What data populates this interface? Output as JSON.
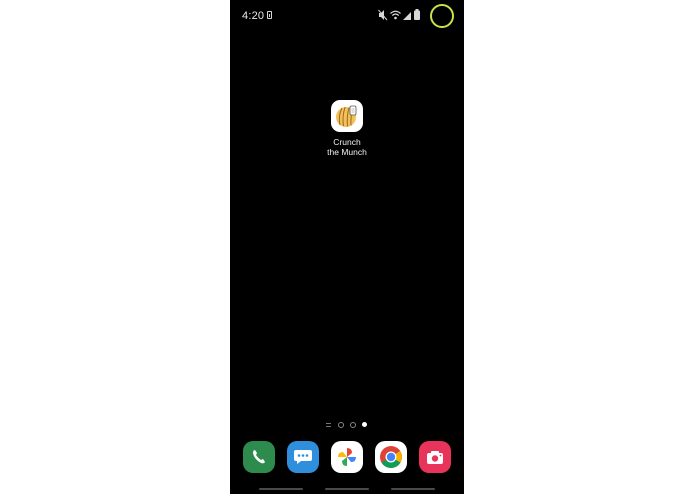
{
  "status_bar": {
    "time": "4:20",
    "icons": [
      "battery-saver-icon",
      "mute-icon",
      "wifi-icon",
      "signal-icon",
      "battery-icon"
    ]
  },
  "home_screen": {
    "apps": [
      {
        "label_line1": "Crunch",
        "label_line2": "the Munch",
        "icon": "crunch-the-munch-icon"
      }
    ],
    "page_indicator": {
      "pages": 3,
      "active_page": 3
    }
  },
  "dock": {
    "apps": [
      {
        "name": "Phone",
        "icon": "phone-icon",
        "color": "#2e8b4e"
      },
      {
        "name": "Messages",
        "icon": "messages-icon",
        "color": "#2f8fdc"
      },
      {
        "name": "Photos",
        "icon": "pinwheel-icon",
        "color": "#ffffff"
      },
      {
        "name": "Chrome",
        "icon": "chrome-icon",
        "color": "#ffffff"
      },
      {
        "name": "Camera",
        "icon": "camera-icon",
        "color": "#e8335a"
      }
    ]
  },
  "colors": {
    "screen_bg": "#000000",
    "cursor_ring": "#c9e34a"
  }
}
